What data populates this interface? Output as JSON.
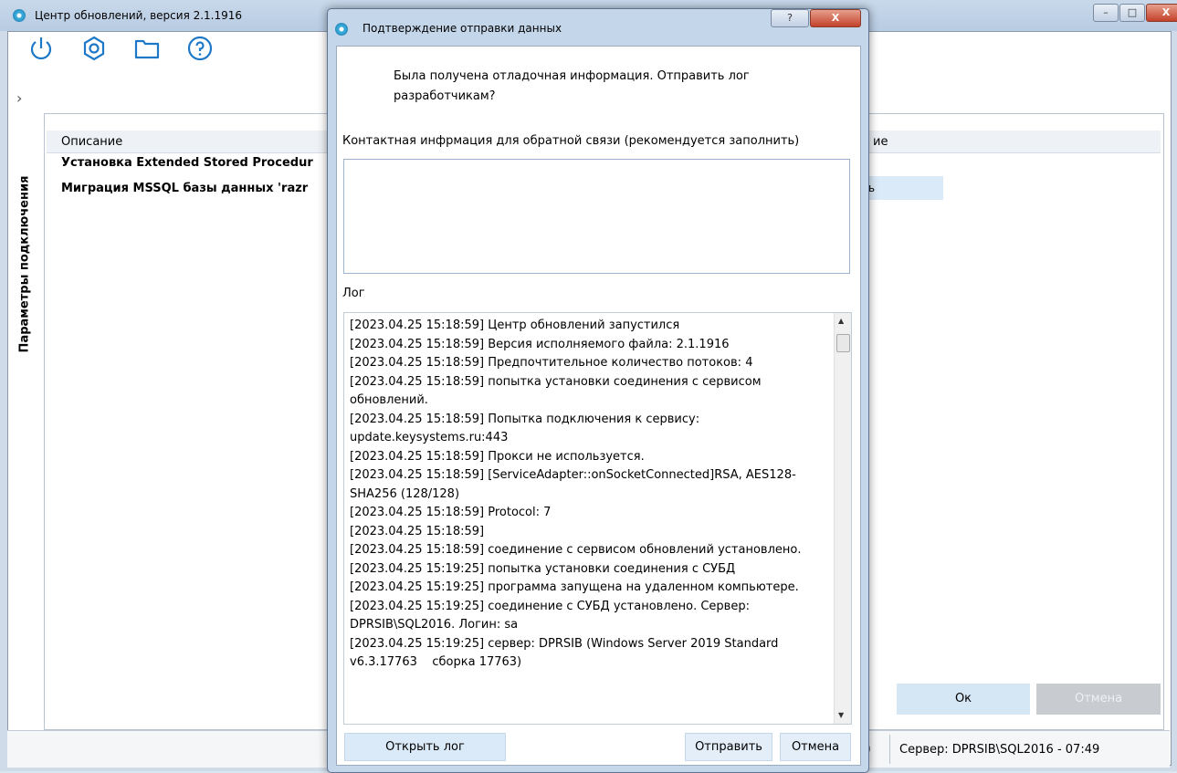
{
  "main": {
    "title": "Центр обновлений, версия 2.1.1916",
    "toolbar": [
      "power-icon",
      "settings-icon",
      "folder-icon",
      "help-icon"
    ],
    "side_panel_label": "Параметры подключения",
    "side_arrow": "›",
    "columns": {
      "description": "Описание",
      "state": "ие"
    },
    "tasks": [
      {
        "label": "Установка Extended Stored Procedur"
      },
      {
        "label": "Миграция MSSQL базы данных 'razr",
        "state": "ь"
      }
    ],
    "ok_label": "Ок",
    "cancel_label": "Отмена",
    "status_left": "0",
    "server_status": "Сервер:  DPRSIB\\SQL2016 - 07:49"
  },
  "dialog": {
    "title": "Подтверждение отправки данных",
    "prompt": "Была получена отладочная информация. Отправить лог разработчикам?",
    "contact_label": "Контактная инфрмация для обратной связи (рекомендуется заполнить)",
    "contact_value": "",
    "log_label": "Лог",
    "log_text": "[2023.04.25 15:18:59] Центр обновлений запустился\n[2023.04.25 15:18:59] Версия исполняемого файла: 2.1.1916\n[2023.04.25 15:18:59] Предпочтительное количество потоков: 4\n[2023.04.25 15:18:59] попытка установки соединения с сервисом обновлений.\n[2023.04.25 15:18:59] Попытка подключения к сервису: update.keysystems.ru:443\n[2023.04.25 15:18:59] Прокси не используется.\n[2023.04.25 15:18:59] [ServiceAdapter::onSocketConnected]RSA, AES128-SHA256 (128/128)\n[2023.04.25 15:18:59] Protocol: 7\n[2023.04.25 15:18:59]\n[2023.04.25 15:18:59] соединение с сервисом обновлений установлено.\n[2023.04.25 15:19:25] попытка установки соединения с СУБД\n[2023.04.25 15:19:25] программа запущена на удаленном компьютере.\n[2023.04.25 15:19:25] соединение с СУБД установлено. Сервер: DPRSIB\\SQL2016. Логин: sa\n[2023.04.25 15:19:25] сервер: DPRSIB (Windows Server 2019 Standard v6.3.17763    сборка 17763)",
    "open_log_label": "Открыть лог",
    "send_label": "Отправить",
    "cancel_label": "Отмена",
    "help_glyph": "?",
    "close_glyph": "X"
  },
  "window_buttons": {
    "minimize": "–",
    "maximize": "□",
    "close": "X"
  },
  "colors": {
    "accent": "#1e78c8",
    "titlebar": "#c4d6ea",
    "button_bg": "#dbeaf8"
  }
}
